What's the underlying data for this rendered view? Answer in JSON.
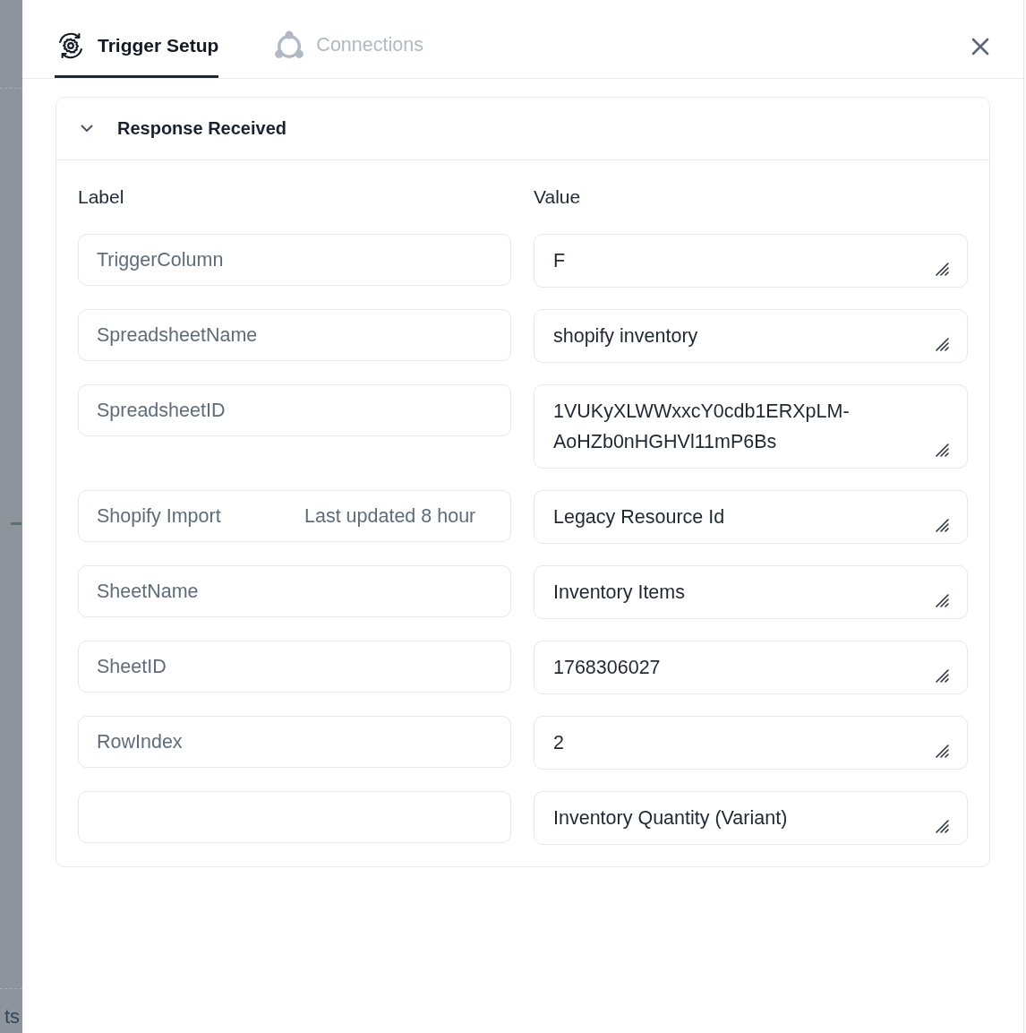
{
  "backdrop": {
    "text": "ts"
  },
  "tabs": [
    {
      "label": "Trigger Setup",
      "selected": true,
      "kind": "trigger"
    },
    {
      "label": "Connections",
      "selected": false,
      "kind": "connections"
    }
  ],
  "section": {
    "title": "Response Received",
    "expanded": true,
    "columns": [
      "Label",
      "Value"
    ],
    "rows": [
      {
        "label": "TriggerColumn",
        "value": "F"
      },
      {
        "label": "SpreadsheetName",
        "value": "shopify inventory"
      },
      {
        "label": "SpreadsheetID",
        "value": "1VUKyXLWWxxcY0cdb1ERXpLM-AoHZb0nHGHVl11mP6Bs"
      },
      {
        "label": "Shopify Import",
        "note": "Last updated 8 hour",
        "value": "Legacy Resource Id"
      },
      {
        "label": "SheetName",
        "value": "Inventory Items"
      },
      {
        "label": "SheetID",
        "value": "1768306027"
      },
      {
        "label": "RowIndex",
        "value": "2"
      },
      {
        "value": "Inventory Quantity (Variant)"
      }
    ]
  }
}
